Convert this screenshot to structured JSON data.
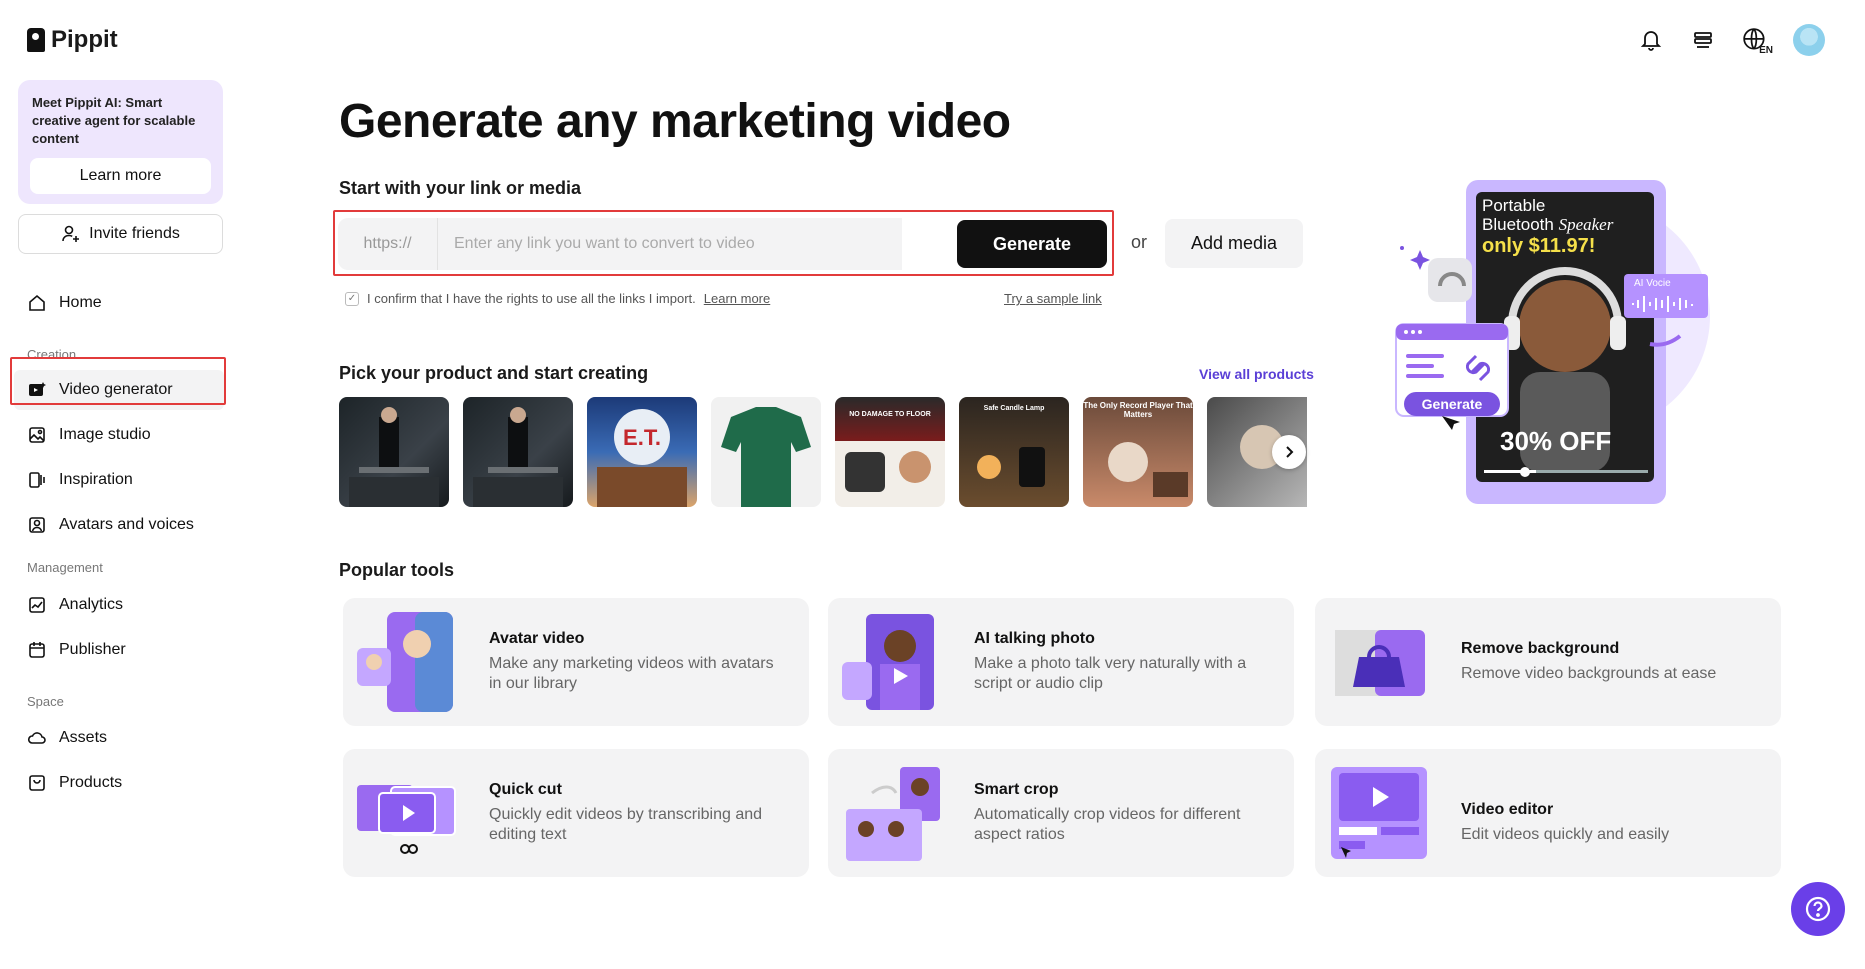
{
  "app": {
    "name": "Pippit"
  },
  "sidebar": {
    "promo": {
      "text": "Meet Pippit AI: Smart creative agent for scalable content",
      "button": "Learn more"
    },
    "invite": "Invite friends",
    "home": "Home",
    "sections": {
      "creation": "Creation",
      "management": "Management",
      "space": "Space"
    },
    "items": {
      "video_generator": "Video generator",
      "image_studio": "Image studio",
      "inspiration": "Inspiration",
      "avatars": "Avatars and voices",
      "analytics": "Analytics",
      "publisher": "Publisher",
      "assets": "Assets",
      "products": "Products"
    }
  },
  "topbar": {
    "lang": "EN"
  },
  "main": {
    "title": "Generate any marketing video",
    "start_heading": "Start with your link or media",
    "link_prefix": "https://",
    "link_placeholder": "Enter any link you want to convert to video",
    "generate": "Generate",
    "or": "or",
    "add_media": "Add media",
    "confirm_text": "I confirm that I have the rights to use all the links I import.",
    "confirm_link": "Learn more",
    "sample_link": "Try a sample link",
    "pick_heading": "Pick your product and start creating",
    "view_all": "View all products",
    "product_labels": {
      "p5": "NO DAMAGE TO FLOOR",
      "p6": "Safe Candle Lamp",
      "p7": "The Only Record Player That Matters",
      "p3": "E.T."
    },
    "popular_heading": "Popular tools",
    "tools": [
      {
        "title": "Avatar video",
        "desc": "Make any marketing videos with avatars in our library"
      },
      {
        "title": "AI talking photo",
        "desc": "Make a photo talk very naturally with a script or audio clip"
      },
      {
        "title": "Remove background",
        "desc": "Remove video backgrounds at ease"
      },
      {
        "title": "Quick cut",
        "desc": "Quickly edit videos by transcribing and editing text"
      },
      {
        "title": "Smart crop",
        "desc": "Automatically crop videos for different aspect ratios"
      },
      {
        "title": "Video editor",
        "desc": "Edit videos quickly and easily"
      }
    ]
  },
  "hero": {
    "line1": "Portable",
    "line2a": "Bluetooth ",
    "line2b": "Speaker",
    "price": "only $11.97!",
    "ai_voice": "AI Vocie",
    "generate": "Generate",
    "off": "30% OFF"
  },
  "colors": {
    "accent": "#6a3fe8",
    "highlight": "#e23b3b"
  }
}
